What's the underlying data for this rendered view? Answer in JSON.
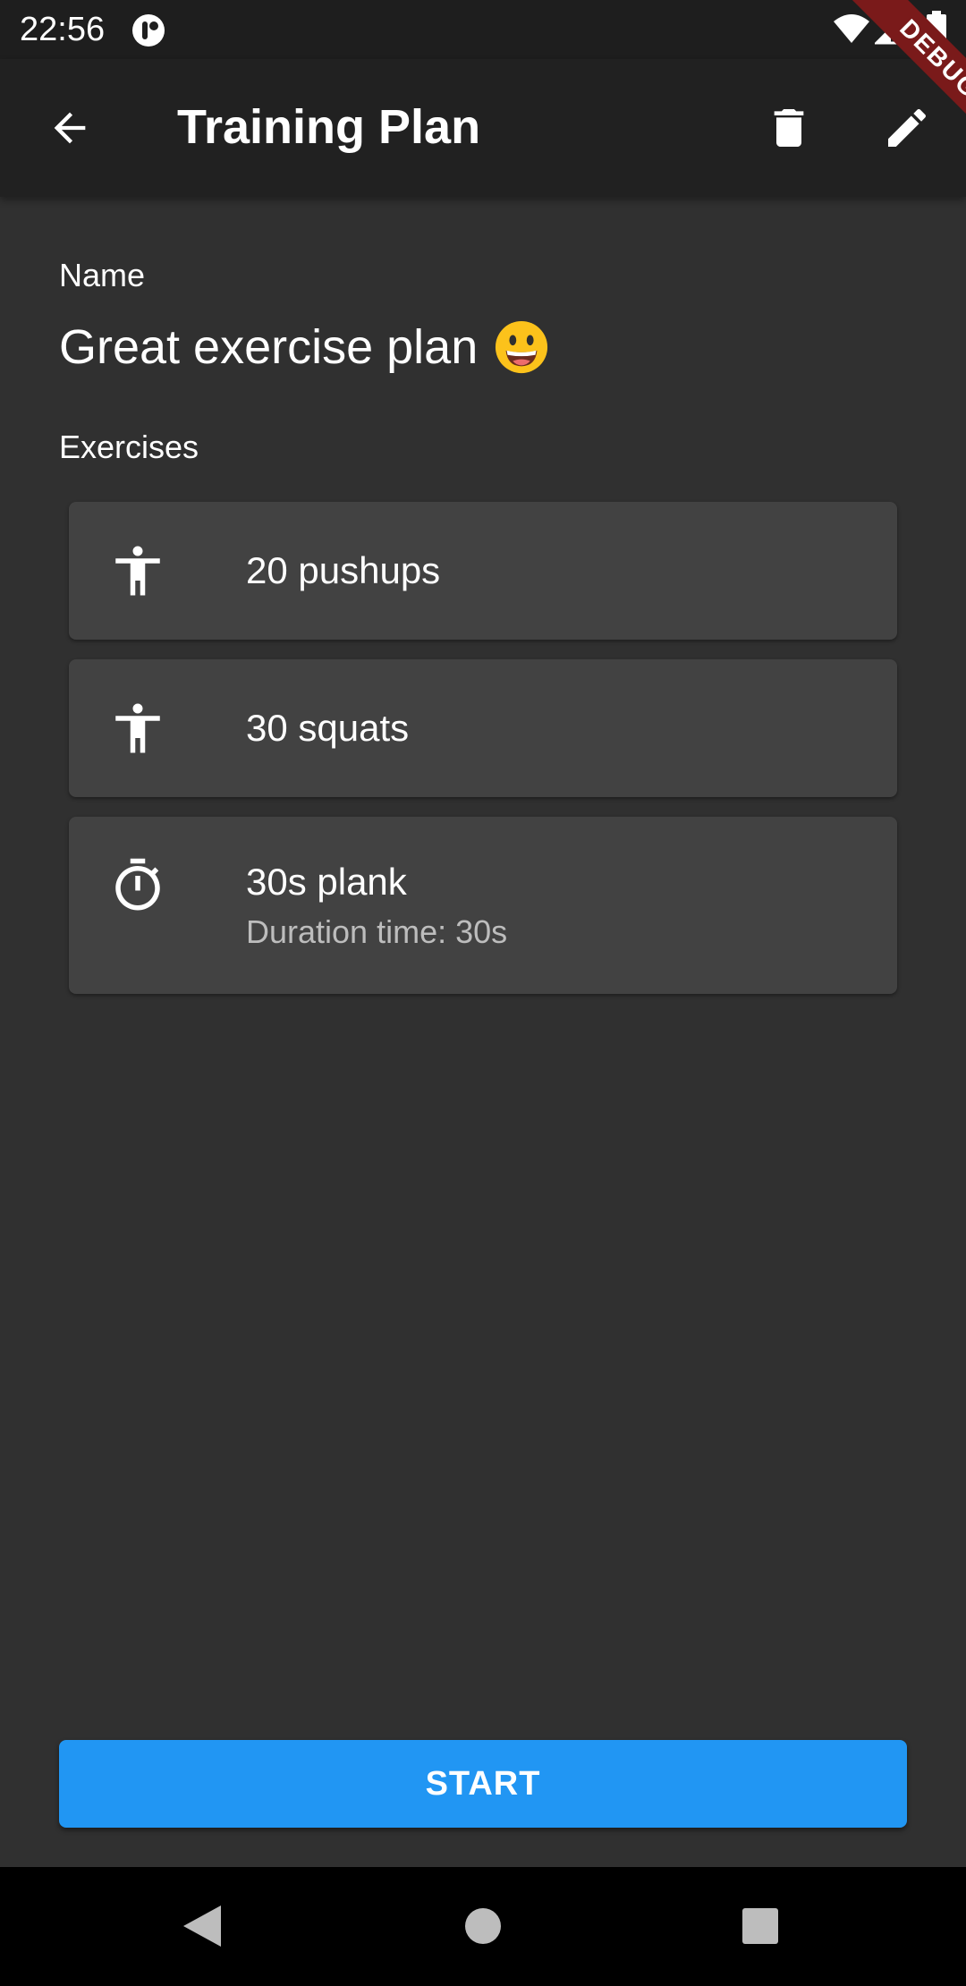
{
  "status_bar": {
    "time": "22:56"
  },
  "debug_banner": "DEBUG",
  "app_bar": {
    "title": "Training Plan",
    "icons": [
      "back-arrow-icon",
      "delete-icon",
      "edit-icon"
    ]
  },
  "plan": {
    "name_label": "Name",
    "name": "Great exercise plan",
    "name_emoji": "grinning-face",
    "exercises_label": "Exercises"
  },
  "exercises": [
    {
      "icon": "accessibility-icon",
      "title": "20 pushups",
      "subtitle": ""
    },
    {
      "icon": "accessibility-icon",
      "title": "30 squats",
      "subtitle": ""
    },
    {
      "icon": "timer-icon",
      "title": "30s plank",
      "subtitle": "Duration time: 30s"
    }
  ],
  "start_button": {
    "label": "START"
  },
  "colors": {
    "background": "#303030",
    "app_bar": "#212121",
    "card": "#424242",
    "accent": "#2196f3",
    "debug_ribbon": "#7a1a1a"
  }
}
